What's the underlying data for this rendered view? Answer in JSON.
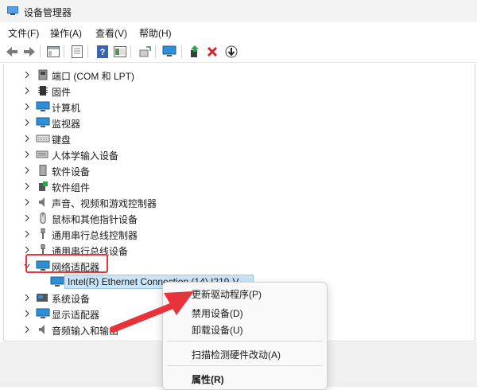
{
  "window": {
    "title": "设备管理器"
  },
  "menubar": {
    "items": [
      "文件(F)",
      "操作(A)",
      "查看(V)",
      "帮助(H)"
    ]
  },
  "toolbar": {
    "icons": [
      "back-arrow-icon",
      "forward-arrow-icon",
      "show-hide-tree-icon",
      "properties-icon",
      "help-icon",
      "view-icon",
      "scan-hardware-icon",
      "monitor-icon",
      "update-driver-icon",
      "uninstall-icon",
      "disable-icon"
    ]
  },
  "tree": {
    "items": [
      {
        "label": "端口 (COM 和 LPT)",
        "icon": "port-icon"
      },
      {
        "label": "固件",
        "icon": "firmware-icon"
      },
      {
        "label": "计算机",
        "icon": "computer-icon"
      },
      {
        "label": "监视器",
        "icon": "monitor-icon"
      },
      {
        "label": "键盘",
        "icon": "keyboard-icon"
      },
      {
        "label": "人体学输入设备",
        "icon": "hid-icon"
      },
      {
        "label": "软件设备",
        "icon": "software-device-icon"
      },
      {
        "label": "软件组件",
        "icon": "software-component-icon"
      },
      {
        "label": "声音、视频和游戏控制器",
        "icon": "sound-icon"
      },
      {
        "label": "鼠标和其他指针设备",
        "icon": "mouse-icon"
      },
      {
        "label": "通用串行总线控制器",
        "icon": "usb-icon"
      },
      {
        "label": "通用串行总线设备",
        "icon": "usb-icon"
      }
    ],
    "network": {
      "label": "网络适配器",
      "child": "Intel(R) Ethernet Connection (14) I219-V"
    },
    "after": [
      {
        "label": "系统设备",
        "icon": "system-device-icon"
      },
      {
        "label": "显示适配器",
        "icon": "display-adapter-icon"
      },
      {
        "label": "音频输入和输出",
        "icon": "audio-io-icon"
      }
    ]
  },
  "context_menu": {
    "items": [
      "更新驱动程序(P)",
      "禁用设备(D)",
      "卸载设备(U)",
      "扫描检测硬件改动(A)",
      "属性(R)"
    ]
  },
  "colors": {
    "annotation_red": "#e8333a",
    "selection": "#cce4f7"
  }
}
